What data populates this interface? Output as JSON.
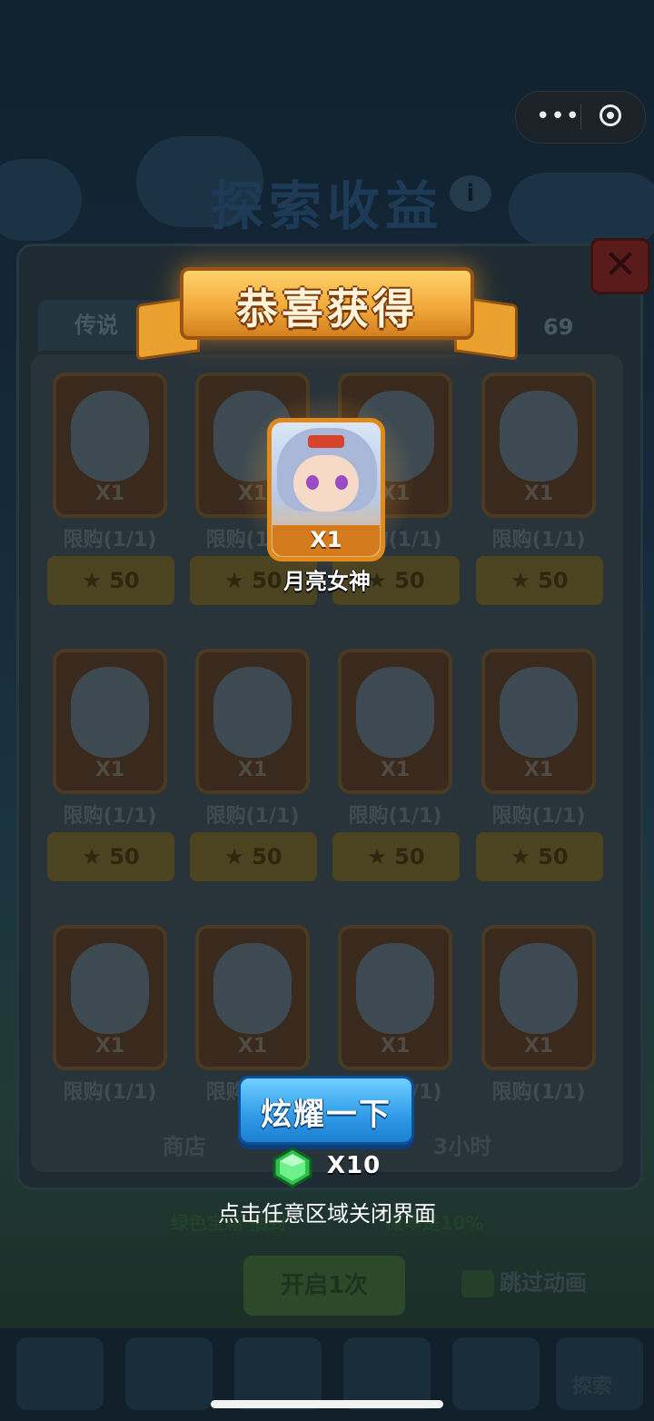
{
  "background": {
    "title": "探索收益",
    "tab_label": "传说",
    "count": "69",
    "cards": [
      {
        "qty": "X1",
        "limit": "限购(1/1)",
        "price": "50"
      },
      {
        "qty": "X1",
        "limit": "限购(1/1)",
        "price": "50"
      },
      {
        "qty": "X1",
        "limit": "限购(1/1)",
        "price": "50"
      },
      {
        "qty": "X1",
        "limit": "限购(1/1)",
        "price": "50"
      },
      {
        "qty": "X1",
        "limit": "限购(1/1)",
        "price": "50"
      },
      {
        "qty": "X1",
        "limit": "限购(1/1)",
        "price": "50"
      },
      {
        "qty": "X1",
        "limit": "限购(1/1)",
        "price": "50"
      },
      {
        "qty": "X1",
        "limit": "限购(1/1)",
        "price": "50"
      },
      {
        "qty": "X1",
        "limit": "限购(1/1)",
        "price": ""
      },
      {
        "qty": "X1",
        "limit": "限购(1/1)",
        "price": ""
      },
      {
        "qty": "X1",
        "limit": "限购(1/1)",
        "price": ""
      },
      {
        "qty": "X1",
        "limit": "限购(1/1)",
        "price": ""
      }
    ],
    "shop_note": "商店",
    "shop_note_tail": "3小时",
    "green_note_prefix": "绿色宝箱",
    "green_note_suffix": "抽到",
    "green_note_rate": "概率是10%",
    "open_button": "开启1次",
    "skip_animation": "跳过动画",
    "nav_explore": "探索"
  },
  "overlay": {
    "banner_title": "恭喜获得",
    "reward": {
      "qty": "X1",
      "name": "月亮女神"
    },
    "show_off_button": "炫耀一下",
    "gem_qty": "X10",
    "close_hint": "点击任意区域关闭界面"
  },
  "system": {
    "more_icon": "more-dots-icon",
    "close_app_icon": "target-icon"
  },
  "colors": {
    "banner": "#f0a637",
    "button_blue": "#2f9be8",
    "gem_green": "#3ad157"
  }
}
